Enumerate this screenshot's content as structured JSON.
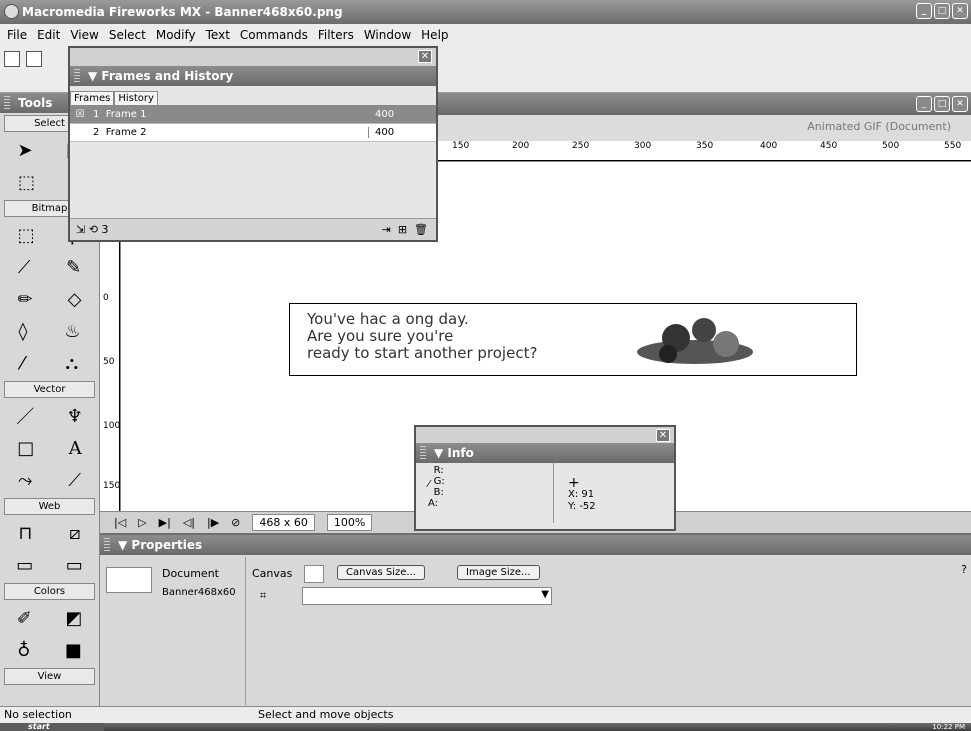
{
  "window": {
    "title": "Macromedia Fireworks MX - Banner468x60.png"
  },
  "menu": [
    "File",
    "Edit",
    "View",
    "Select",
    "Modify",
    "Text",
    "Commands",
    "Filters",
    "Window",
    "Help"
  ],
  "tools": {
    "title": "Tools",
    "sections": [
      "Select",
      "Bitmap",
      "Vector",
      "Web",
      "Colors",
      "View"
    ]
  },
  "frames_panel": {
    "title": "Frames and History",
    "tabs": [
      "Frames",
      "History"
    ],
    "rows": [
      {
        "num": "1",
        "name": "Frame 1",
        "delay": "400",
        "selected": true
      },
      {
        "num": "2",
        "name": "Frame 2",
        "delay": "400",
        "selected": false
      }
    ],
    "onion_count": "3"
  },
  "document": {
    "mode_label": "Animated GIF (Document)",
    "ruler_h": [
      "150",
      "200",
      "250",
      "300",
      "350",
      "400",
      "450",
      "500",
      "550"
    ],
    "ruler_v": [
      "0",
      "50",
      "100",
      "150"
    ],
    "size": "468 x 60",
    "zoom": "100%"
  },
  "banner": {
    "line1": "You've hac a ong day.",
    "line2": "Are you sure you're",
    "line3": "ready to start another project?"
  },
  "info_panel": {
    "title": "Info",
    "r": "R:",
    "g": "G:",
    "b": "B:",
    "a": "A:",
    "x": "X: 91",
    "y": "Y: -52"
  },
  "properties": {
    "title": "Properties",
    "type": "Document",
    "filename": "Banner468x60",
    "canvas_label": "Canvas",
    "canvas_size_btn": "Canvas Size...",
    "image_size_btn": "Image Size..."
  },
  "statusbar": {
    "left": "No selection",
    "middle": "Select and move objects"
  },
  "taskbar": {
    "start": "start",
    "time": "10:22 PM"
  }
}
